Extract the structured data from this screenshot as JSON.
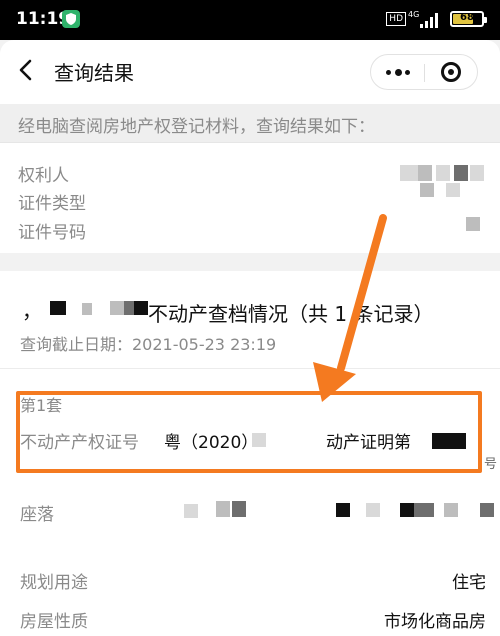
{
  "status_bar": {
    "time": "11:19",
    "hd": "HD",
    "network": "4G",
    "battery": "68"
  },
  "nav": {
    "title": "查询结果"
  },
  "notice": "经电脑查阅房地产权登记材料，查询结果如下：",
  "owner_section": {
    "owner_label": "权利人",
    "id_type_label": "证件类型",
    "id_number_label": "证件号码"
  },
  "records": {
    "prefix_char": "，",
    "heading": "不动产查档情况（共 1 条记录）",
    "query_date": "查询截止日期：2021-05-23 23:19",
    "first_item_label": "第1套",
    "cert_label": "不动产产权证号",
    "cert_value_prefix": "粤（2020）",
    "cert_value_suffix": "动产证明第",
    "cert_tail": "号",
    "location_label": "座落",
    "usage_label": "规划用途",
    "usage_value": "住宅",
    "property_label": "房屋性质",
    "property_value": "市场化商品房"
  },
  "accent_colors": {
    "highlight": "#f47a20",
    "shield": "#2fb36b",
    "battery": "#e0c340"
  }
}
